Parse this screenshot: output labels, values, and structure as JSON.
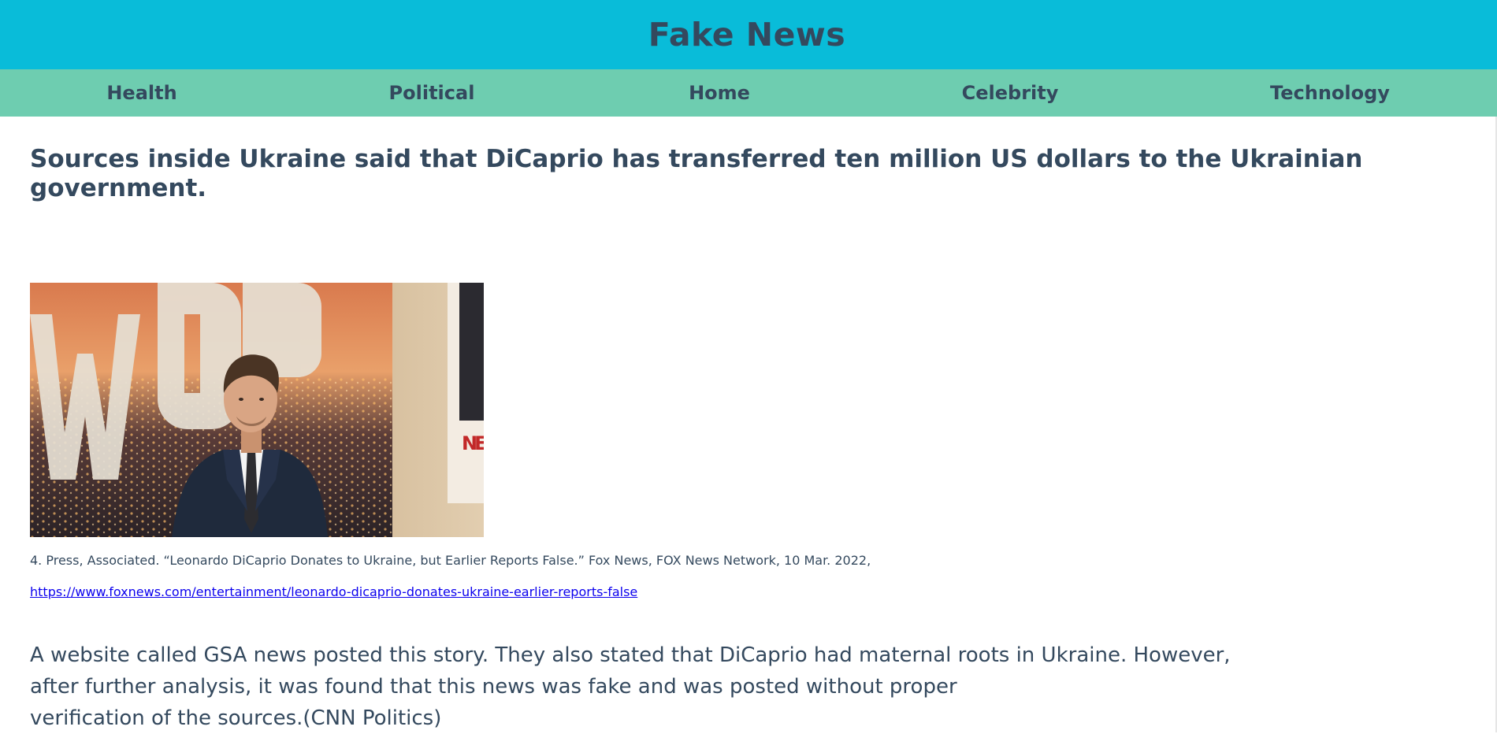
{
  "header": {
    "title": "Fake News"
  },
  "nav": {
    "items": [
      {
        "label": "Health"
      },
      {
        "label": "Political"
      },
      {
        "label": "Home"
      },
      {
        "label": "Celebrity"
      },
      {
        "label": "Technology"
      }
    ]
  },
  "article": {
    "headline": "Sources inside Ukraine said that DiCaprio has transferred ten million US dollars to the Ukrainian government.",
    "image": {
      "alt": "",
      "backdrop_letters": "WOOD",
      "poster_letters": "NE"
    },
    "caption": "4. Press, Associated. “Leonardo DiCaprio Donates to Ukraine, but Earlier Reports False.” Fox News, FOX News Network, 10 Mar. 2022,",
    "source_url": "https://www.foxnews.com/entertainment/leonardo-dicaprio-donates-ukraine-earlier-reports-false",
    "body_lines": [
      "A website called GSA news posted this story. They also stated that DiCaprio had maternal roots in Ukraine. However,",
      "after further analysis, it was found that this news was fake and was posted without proper",
      "verification of the sources.(CNN Politics)"
    ]
  },
  "colors": {
    "header_bg": "#09bcd9",
    "nav_bg": "#6ecdb0",
    "text": "#34495e",
    "link": "#0b00ee"
  }
}
